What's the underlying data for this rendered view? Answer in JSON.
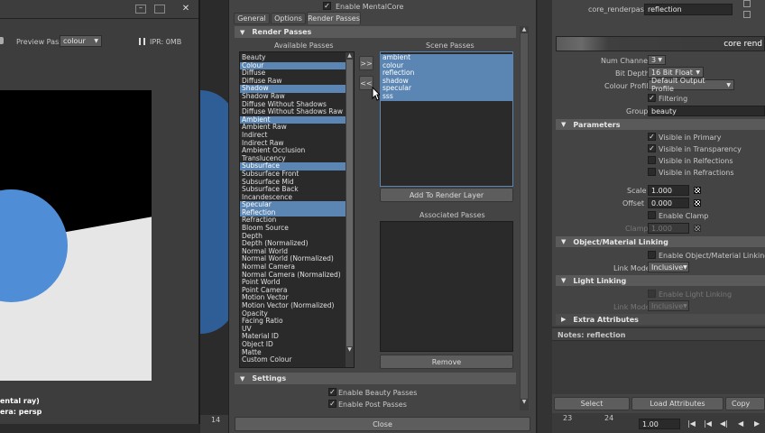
{
  "viewport": {
    "preview_pass_label": "Preview Pass:",
    "preview_pass_value": "colour",
    "ipr_label": "IPR: 0MB",
    "footer_line1": "ental ray)",
    "footer_line2": "era: persp"
  },
  "dialog": {
    "enable_mentalcore": "Enable MentalCore",
    "tabs": [
      "General",
      "Options",
      "Render Passes"
    ],
    "active_tab": "Render Passes",
    "render_passes_section": "Render Passes",
    "available_header": "Available Passes",
    "scene_header": "Scene Passes",
    "move_right": ">>",
    "move_left": "<<",
    "available_passes": [
      {
        "name": "Beauty",
        "selected": false
      },
      {
        "name": "Colour",
        "selected": true
      },
      {
        "name": "Diffuse",
        "selected": false
      },
      {
        "name": "Diffuse Raw",
        "selected": false
      },
      {
        "name": "Shadow",
        "selected": true
      },
      {
        "name": "Shadow Raw",
        "selected": false
      },
      {
        "name": "Diffuse Without Shadows",
        "selected": false
      },
      {
        "name": "Diffuse Without Shadows Raw",
        "selected": false
      },
      {
        "name": "Ambient",
        "selected": true
      },
      {
        "name": "Ambient Raw",
        "selected": false
      },
      {
        "name": "Indirect",
        "selected": false
      },
      {
        "name": "Indirect Raw",
        "selected": false
      },
      {
        "name": "Ambient Occlusion",
        "selected": false
      },
      {
        "name": "Translucency",
        "selected": false
      },
      {
        "name": "Subsurface",
        "selected": true
      },
      {
        "name": "Subsurface Front",
        "selected": false
      },
      {
        "name": "Subsurface Mid",
        "selected": false
      },
      {
        "name": "Subsurface Back",
        "selected": false
      },
      {
        "name": "Incandescence",
        "selected": false
      },
      {
        "name": "Specular",
        "selected": true
      },
      {
        "name": "Reflection",
        "selected": true
      },
      {
        "name": "Refraction",
        "selected": false
      },
      {
        "name": "Bloom Source",
        "selected": false
      },
      {
        "name": "Depth",
        "selected": false
      },
      {
        "name": "Depth (Normalized)",
        "selected": false
      },
      {
        "name": "Normal World",
        "selected": false
      },
      {
        "name": "Normal World (Normalized)",
        "selected": false
      },
      {
        "name": "Normal Camera",
        "selected": false
      },
      {
        "name": "Normal Camera (Normalized)",
        "selected": false
      },
      {
        "name": "Point World",
        "selected": false
      },
      {
        "name": "Point Camera",
        "selected": false
      },
      {
        "name": "Motion Vector",
        "selected": false
      },
      {
        "name": "Motion Vector (Normalized)",
        "selected": false
      },
      {
        "name": "Opacity",
        "selected": false
      },
      {
        "name": "Facing Ratio",
        "selected": false
      },
      {
        "name": "UV",
        "selected": false
      },
      {
        "name": "Material ID",
        "selected": false
      },
      {
        "name": "Object ID",
        "selected": false
      },
      {
        "name": "Matte",
        "selected": false
      },
      {
        "name": "Custom Colour",
        "selected": false
      }
    ],
    "scene_passes": [
      "ambient",
      "colour",
      "reflection",
      "shadow",
      "specular",
      "sss"
    ],
    "add_to_render_layer": "Add To Render Layer",
    "associated_header": "Associated Passes",
    "remove": "Remove",
    "settings_section": "Settings",
    "enable_beauty_passes": "Enable Beauty Passes",
    "enable_post_passes": "Enable Post Passes",
    "close": "Close"
  },
  "attributes": {
    "node_label": "core_renderpass:",
    "node_value": "reflection",
    "node_type_label": "core rend",
    "num_channels_label": "Num Channels",
    "num_channels_value": "3",
    "bit_depth_label": "Bit Depth",
    "bit_depth_value": "16 Bit Float",
    "colour_profile_label": "Colour Profile",
    "colour_profile_value": "Default Output Profile",
    "filtering_label": "Filtering",
    "group_label": "Group",
    "group_value": "beauty",
    "parameters_section": "Parameters",
    "visible_in_primary": "Visible in Primary",
    "visible_in_transparency": "Visible in Transparency",
    "visible_in_reflections": "Visible in Relfections",
    "visible_in_refractions": "Visible in Refractions",
    "scale_label": "Scale",
    "scale_value": "1.000",
    "offset_label": "Offset",
    "offset_value": "0.000",
    "enable_clamp": "Enable Clamp",
    "clamp_label": "Clamp",
    "clamp_value": "1.000",
    "object_material_section": "Object/Material Linking",
    "enable_object_material": "Enable Object/Material Linking",
    "link_mode_label": "Link Mode",
    "link_mode_value": "Inclusive",
    "light_linking_section": "Light Linking",
    "enable_light_linking": "Enable Light Linking",
    "light_link_mode_label": "Link Mode",
    "light_link_mode_value": "Inclusive",
    "extra_attributes_section": "Extra Attributes",
    "notes_label": "Notes:  reflection",
    "select_button": "Select",
    "load_attributes_button": "Load Attributes",
    "copy_button": "Copy"
  },
  "timeline": {
    "tick_14": "14",
    "tick_23": "23",
    "tick_24": "24",
    "frame_value": "1.00"
  }
}
